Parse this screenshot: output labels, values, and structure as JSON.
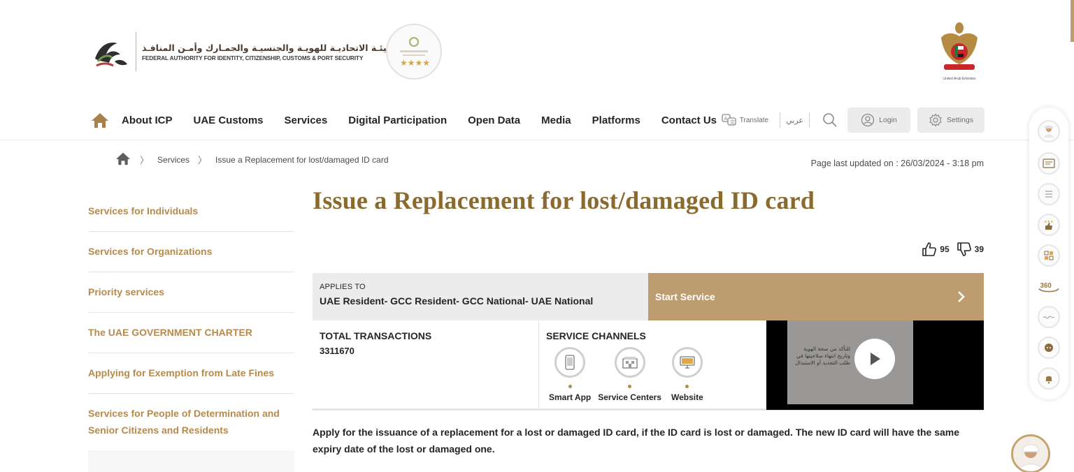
{
  "brand": {
    "arabic_name": "الهيئـة الاتحاديـة للهويـة والجنسيـة والجمـارك وأمـن المنافـذ",
    "english_name": "FEDERAL AUTHORITY FOR IDENTITY, CITIZENSHIP, CUSTOMS & PORT SECURITY",
    "emblem_caption": "United Arab Emirates",
    "accent_color": "#bd9c6f",
    "title_color": "#8b6a2e"
  },
  "nav": {
    "items": [
      "About ICP",
      "UAE Customs",
      "Services",
      "Digital Participation",
      "Open Data",
      "Media",
      "Platforms",
      "Contact Us"
    ],
    "translate_label": "Translate",
    "arabic_label": "عربي",
    "login_label": "Login",
    "settings_label": "Settings"
  },
  "breadcrumb": {
    "items": [
      "Services",
      "Issue a Replacement for lost/damaged ID card"
    ]
  },
  "updated": "Page last updated on : 26/03/2024 - 3:18 pm",
  "sidebar": {
    "items": [
      "Services for Individuals",
      "Services for Organizations",
      "Priority services",
      "The UAE GOVERNMENT CHARTER",
      "Applying for Exemption from Late Fines",
      "Services for People of Determination and Senior Citizens and Residents"
    ]
  },
  "main": {
    "title": "Issue a Replacement for lost/damaged ID card",
    "likes": "95",
    "dislikes": "39",
    "applies_label": "APPLIES TO",
    "applies_value": "UAE Resident- GCC Resident- GCC National- UAE National",
    "start_label": "Start Service",
    "total_label": "TOTAL TRANSACTIONS",
    "total_value": "3311670",
    "channels_label": "SERVICE CHANNELS",
    "channels": [
      "Smart App",
      "Service Centers",
      "Website"
    ],
    "video_text": "للتأكد من صحة الهوية وتاريخ انتهاء صلاحيتها في طلب التجديد أو الاستبدال",
    "description": "Apply for the issuance of a replacement for a lost or damaged ID card, if the ID card is lost or damaged. The new ID card will have the same expiry date of the lost or damaged one."
  },
  "icons": {
    "home": "home-icon",
    "translate": "translate-icon",
    "search": "search-icon",
    "login": "user-icon",
    "settings": "gear-icon",
    "like": "thumbs-up-icon",
    "dislike": "thumbs-down-icon",
    "chevron": "chevron-right-icon",
    "play": "play-icon"
  }
}
